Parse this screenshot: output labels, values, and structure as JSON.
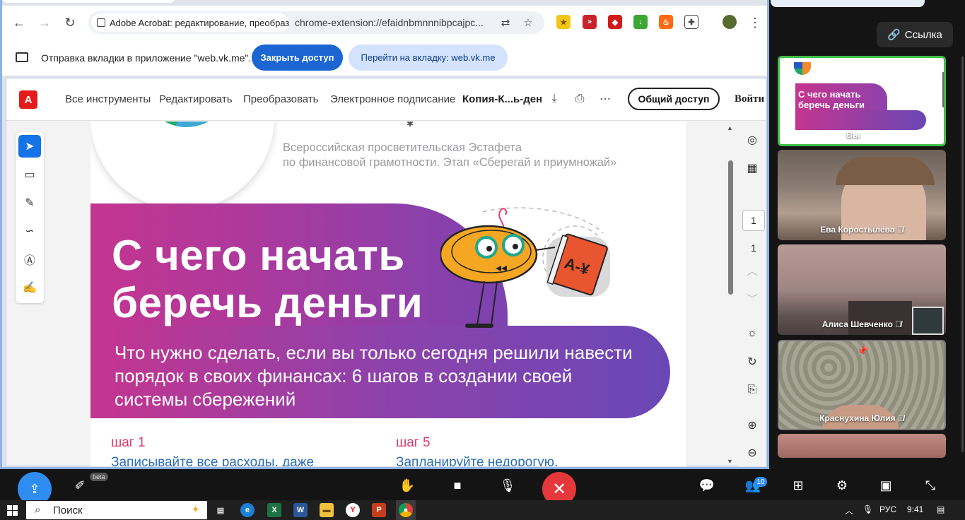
{
  "browser": {
    "tab_title": "Adobe Acrobat: редактирование, преобразо",
    "url": "chrome-extension://efaidnbmnnnibpcajpc...",
    "share_message": "Отправка вкладки в приложение \"web.vk.me\"...",
    "stop_sharing_label": "Закрыть доступ",
    "goto_tab_label": "Перейти на вкладку: web.vk.me"
  },
  "acrobat": {
    "menu": [
      "Все инструменты",
      "Редактировать",
      "Преобразовать",
      "Электронное подписание"
    ],
    "file_name": "Копия-К...ь-ден...",
    "share_label": "Общий доступ",
    "login_label": "Войти",
    "page_current": "1",
    "page_total": "1"
  },
  "pdf": {
    "header_line1": "Всероссийская просветительская Эстафета",
    "header_line2": "по финансовой грамотности.   Этап «Сберегай и приумножай»",
    "title_line1": "С чего начать",
    "title_line2": "беречь деньги",
    "subtitle_line1": "Что нужно сделать, если вы только сегодня решили навести",
    "subtitle_line2": "порядок в своих финансах: 6 шагов в создании своей",
    "subtitle_line3": "системы сбережений",
    "book_label": "A-¥",
    "step1_label": "шаг 1",
    "step1_text": "Записывайте все расходы, даже",
    "step5_label": "шаг 5",
    "step5_text": "Запланируйте недорогую,"
  },
  "call": {
    "link_label": "Ссылка",
    "participants": [
      {
        "name": "Вы"
      },
      {
        "name": "Ева Коростылёва"
      },
      {
        "name": "Алиса Шевченко"
      },
      {
        "name": "Краснухина Юлия"
      }
    ],
    "beta_label": "beta",
    "participants_count": "10"
  },
  "taskbar": {
    "search_placeholder": "Поиск",
    "language": "РУС",
    "time": "9:41"
  },
  "colors": {
    "accent_blue": "#1b66d2",
    "acrobat_red": "#e31b1b",
    "hangup_red": "#e5383b",
    "active_speaker_green": "#3fbf46"
  }
}
